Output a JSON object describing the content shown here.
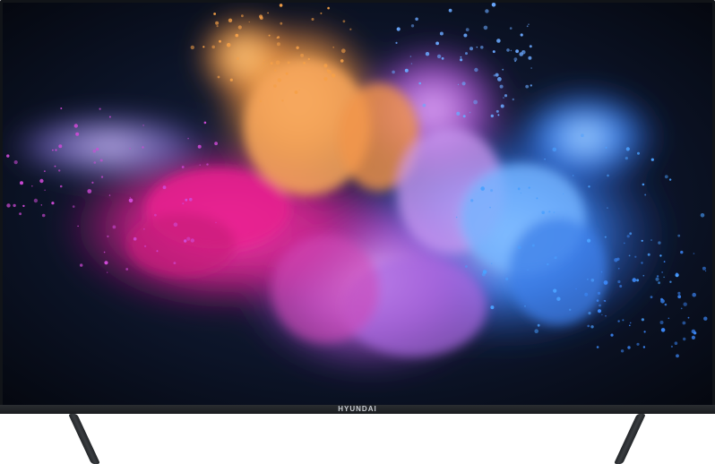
{
  "device": {
    "brand_label": "HYUNDAI"
  },
  "screen": {
    "content_description_icon": "color-powder-explosion-image"
  },
  "colors": {
    "bezel": "#111418",
    "pink": "#e0278f",
    "orange": "#f5a048",
    "purple": "#b05ad8",
    "blue": "#3f8cff",
    "background": "#0a1020"
  }
}
